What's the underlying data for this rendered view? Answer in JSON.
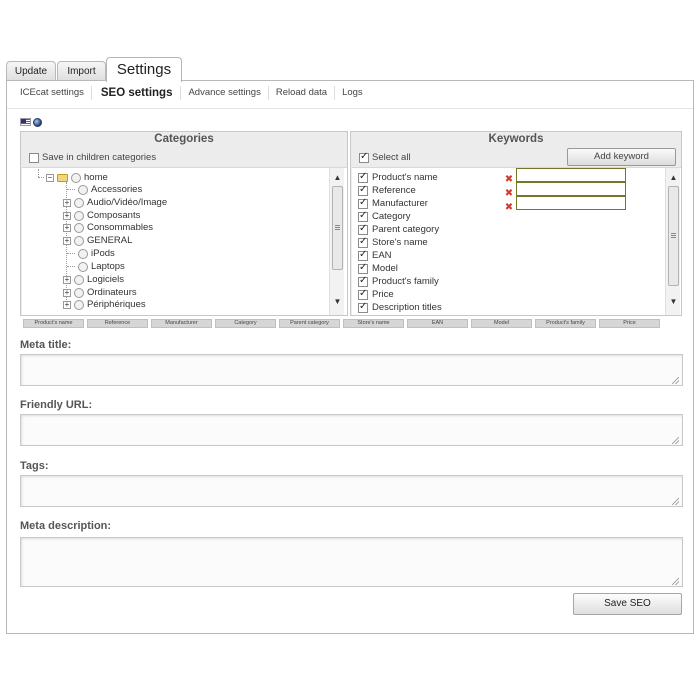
{
  "main_tabs": [
    {
      "label": "Update"
    },
    {
      "label": "Import"
    },
    {
      "label": "Settings",
      "active": true
    }
  ],
  "sub_tabs": [
    {
      "label": "ICEcat settings"
    },
    {
      "label": "SEO settings",
      "active": true
    },
    {
      "label": "Advance settings"
    },
    {
      "label": "Reload data"
    },
    {
      "label": "Logs"
    }
  ],
  "categories": {
    "title": "Categories",
    "save_in_children_label": "Save in children categories",
    "save_in_children_checked": false,
    "tree": {
      "root": {
        "label": "home",
        "expanded": true
      },
      "children": [
        {
          "label": "Accessories",
          "expandable": false
        },
        {
          "label": "Audio/Vidéo/Image",
          "expandable": true
        },
        {
          "label": "Composants",
          "expandable": true
        },
        {
          "label": "Consommables",
          "expandable": true
        },
        {
          "label": "GENERAL",
          "expandable": true
        },
        {
          "label": "iPods",
          "expandable": false
        },
        {
          "label": "Laptops",
          "expandable": false
        },
        {
          "label": "Logiciels",
          "expandable": true
        },
        {
          "label": "Ordinateurs",
          "expandable": true
        },
        {
          "label": "Périphériques",
          "expandable": true
        }
      ]
    }
  },
  "keywords": {
    "title": "Keywords",
    "select_all_label": "Select all",
    "select_all_checked": true,
    "add_keyword_label": "Add keyword",
    "items": [
      {
        "label": "Product's name",
        "checked": true
      },
      {
        "label": "Reference",
        "checked": true
      },
      {
        "label": "Manufacturer",
        "checked": true
      },
      {
        "label": "Category",
        "checked": true
      },
      {
        "label": "Parent category",
        "checked": true
      },
      {
        "label": "Store's name",
        "checked": true
      },
      {
        "label": "EAN",
        "checked": true
      },
      {
        "label": "Model",
        "checked": true
      },
      {
        "label": "Product's family",
        "checked": true
      },
      {
        "label": "Price",
        "checked": true
      },
      {
        "label": "Description titles",
        "checked": true
      }
    ],
    "custom_inputs": [
      "",
      "",
      ""
    ]
  },
  "keyword_pills": [
    "Product's name",
    "Reference",
    "Manufacturer",
    "Category",
    "Parent category",
    "Store's name",
    "EAN",
    "Model",
    "Product's family",
    "Price"
  ],
  "fields": {
    "meta_title": {
      "label": "Meta title:",
      "value": ""
    },
    "friendly_url": {
      "label": "Friendly URL:",
      "value": ""
    },
    "tags": {
      "label": "Tags:",
      "value": ""
    },
    "meta_description": {
      "label": "Meta description:",
      "value": ""
    }
  },
  "save_button_label": "Save SEO",
  "colors": {
    "panel_bg": "#ececec",
    "input_border_highlight": "#76762a",
    "delete_icon": "#d43a2f"
  },
  "icons": {
    "flag": "us-flag-icon",
    "globe": "globe-icon",
    "delete": "delete-x-icon",
    "folder": "folder-open-icon"
  }
}
